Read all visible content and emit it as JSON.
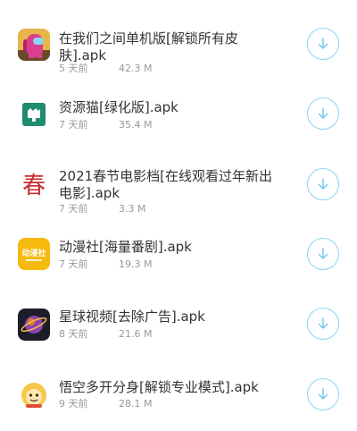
{
  "files": [
    {
      "title_line1": "在我们之间单机版[解锁所有皮",
      "title_line2": "肤].apk",
      "date": "5 天前",
      "size": "42.3 M",
      "icon": "among-us-crewmate-icon"
    },
    {
      "title_line1": "资源猫[绿化版].apk",
      "date": "7 天前",
      "size": "35.4 M",
      "icon": "resource-cat-icon"
    },
    {
      "title_line1": "2021春节电影档[在线观看过年新出",
      "title_line2": "电影].apk",
      "date": "7 天前",
      "size": "3.3 M",
      "icon": "spring-festival-icon",
      "icon_glyph": "春"
    },
    {
      "title_line1": "动漫社[海量番剧].apk",
      "date": "7 天前",
      "size": "19.3 M",
      "icon": "anime-club-icon",
      "icon_glyph": "动漫社"
    },
    {
      "title_line1": "星球视频[去除广告].apk",
      "date": "8 天前",
      "size": "21.6 M",
      "icon": "planet-video-icon"
    },
    {
      "title_line1": "悟空多开分身[解锁专业模式].apk",
      "date": "9 天前",
      "size": "28.1 M",
      "icon": "wukong-clone-icon"
    }
  ],
  "colors": {
    "title": "#333333",
    "meta": "#999999",
    "download_ring": "#8ad4f3",
    "download_arrow": "#6cc6ee"
  },
  "download_icon": "download-arrow-icon"
}
